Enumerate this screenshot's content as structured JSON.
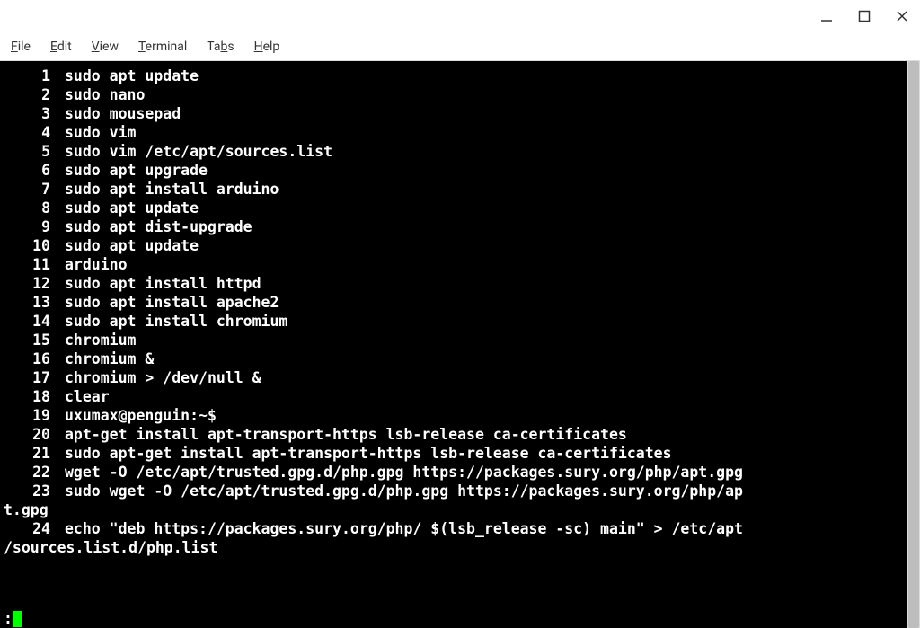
{
  "menubar": {
    "file": "File",
    "edit": "Edit",
    "view": "View",
    "terminal": "Terminal",
    "tabs": "Tabs",
    "help": "Help"
  },
  "lines": [
    {
      "n": "1",
      "t": "sudo apt update"
    },
    {
      "n": "2",
      "t": "sudo nano"
    },
    {
      "n": "3",
      "t": "sudo mousepad"
    },
    {
      "n": "4",
      "t": "sudo vim"
    },
    {
      "n": "5",
      "t": "sudo vim /etc/apt/sources.list"
    },
    {
      "n": "6",
      "t": "sudo apt upgrade"
    },
    {
      "n": "7",
      "t": "sudo apt install arduino"
    },
    {
      "n": "8",
      "t": "sudo apt update"
    },
    {
      "n": "9",
      "t": "sudo apt dist-upgrade"
    },
    {
      "n": "10",
      "t": "sudo apt update"
    },
    {
      "n": "11",
      "t": "arduino"
    },
    {
      "n": "12",
      "t": "sudo apt install httpd"
    },
    {
      "n": "13",
      "t": "sudo apt install apache2"
    },
    {
      "n": "14",
      "t": "sudo apt install chromium"
    },
    {
      "n": "15",
      "t": "chromium"
    },
    {
      "n": "16",
      "t": "chromium &"
    },
    {
      "n": "17",
      "t": "chromium > /dev/null &"
    },
    {
      "n": "18",
      "t": "clear"
    },
    {
      "n": "19",
      "t": "uxumax@penguin:~$"
    },
    {
      "n": "20",
      "t": "apt-get install apt-transport-https lsb-release ca-certificates"
    },
    {
      "n": "21",
      "t": "sudo apt-get install apt-transport-https lsb-release ca-certificates"
    },
    {
      "n": "22",
      "t": "wget -O /etc/apt/trusted.gpg.d/php.gpg https://packages.sury.org/php/apt.gpg"
    },
    {
      "n": "23",
      "t": "sudo wget -O /etc/apt/trusted.gpg.d/php.gpg https://packages.sury.org/php/ap"
    }
  ],
  "wrap23": "t.gpg",
  "line24": {
    "n": "24",
    "t": "echo \"deb https://packages.sury.org/php/ $(lsb_release -sc) main\" > /etc/apt"
  },
  "wrap24": "/sources.list.d/php.list",
  "prompt": ":"
}
